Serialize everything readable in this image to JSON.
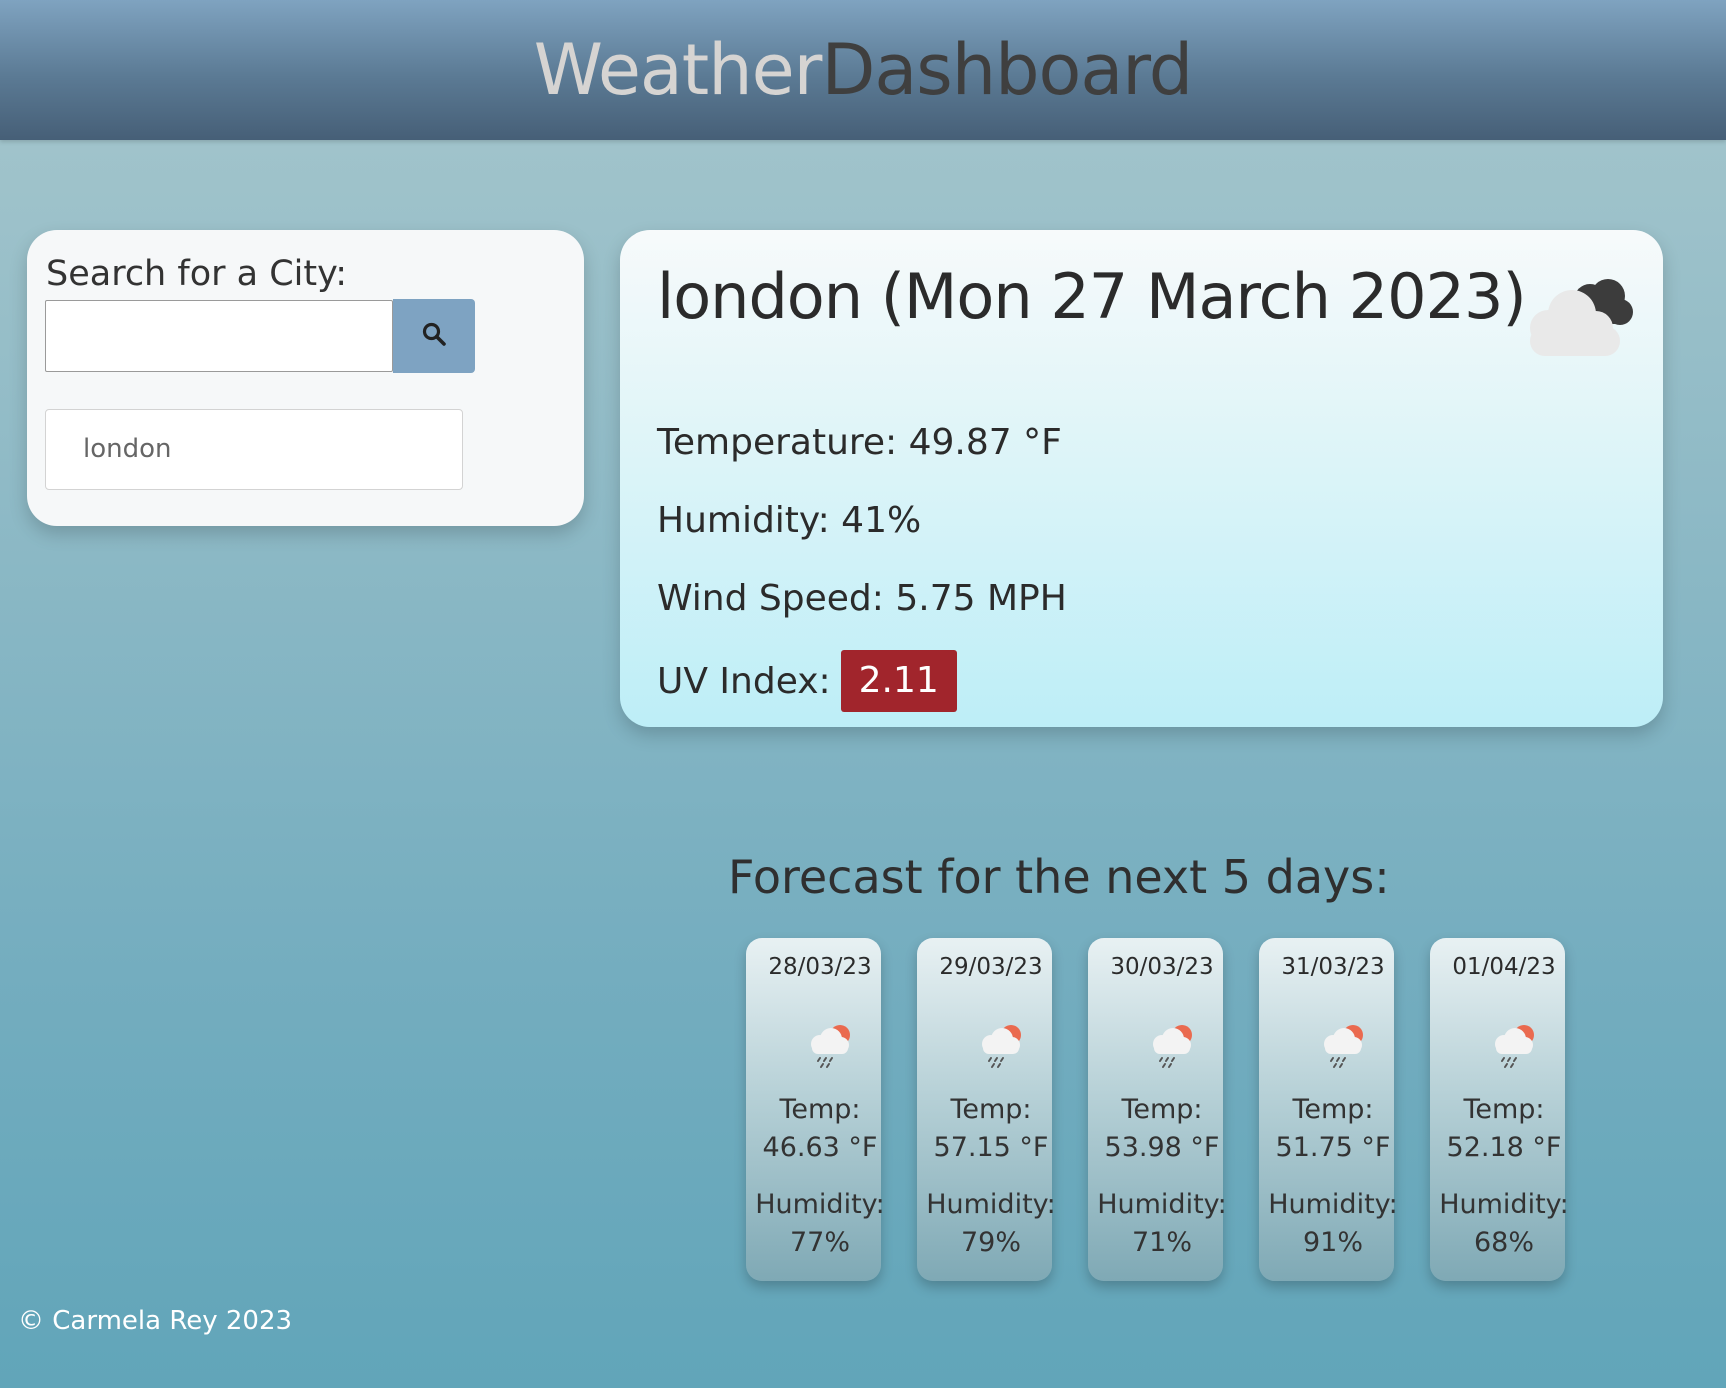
{
  "header": {
    "title_part1": "Weather",
    "title_part2": "Dashboard"
  },
  "search": {
    "label": "Search for a City:",
    "input_value": "",
    "placeholder": "",
    "button_icon": "search-icon",
    "history": [
      "london"
    ]
  },
  "current": {
    "title": "london (Mon 27 March 2023)",
    "icon": "broken-clouds-icon",
    "temperature": "Temperature: 49.87 °F",
    "humidity": "Humidity: 41%",
    "wind": "Wind Speed: 5.75 MPH",
    "uv_label": "UV Index:",
    "uv_value": "2.11",
    "uv_color": "#a1252c"
  },
  "forecast": {
    "heading": "Forecast for the next 5 days:",
    "days": [
      {
        "date": "28/03/23",
        "icon": "light-rain-icon",
        "temp_label": "Temp:",
        "temp": "46.63 °F",
        "humidity_label": "Humidity:",
        "humidity": "77%"
      },
      {
        "date": "29/03/23",
        "icon": "light-rain-icon",
        "temp_label": "Temp:",
        "temp": "57.15 °F",
        "humidity_label": "Humidity:",
        "humidity": "79%"
      },
      {
        "date": "30/03/23",
        "icon": "light-rain-icon",
        "temp_label": "Temp:",
        "temp": "53.98 °F",
        "humidity_label": "Humidity:",
        "humidity": "71%"
      },
      {
        "date": "31/03/23",
        "icon": "light-rain-icon",
        "temp_label": "Temp:",
        "temp": "51.75 °F",
        "humidity_label": "Humidity:",
        "humidity": "91%"
      },
      {
        "date": "01/04/23",
        "icon": "light-rain-icon",
        "temp_label": "Temp:",
        "temp": "52.18 °F",
        "humidity_label": "Humidity:",
        "humidity": "68%"
      }
    ]
  },
  "footer": {
    "text": "© Carmela Rey 2023"
  }
}
